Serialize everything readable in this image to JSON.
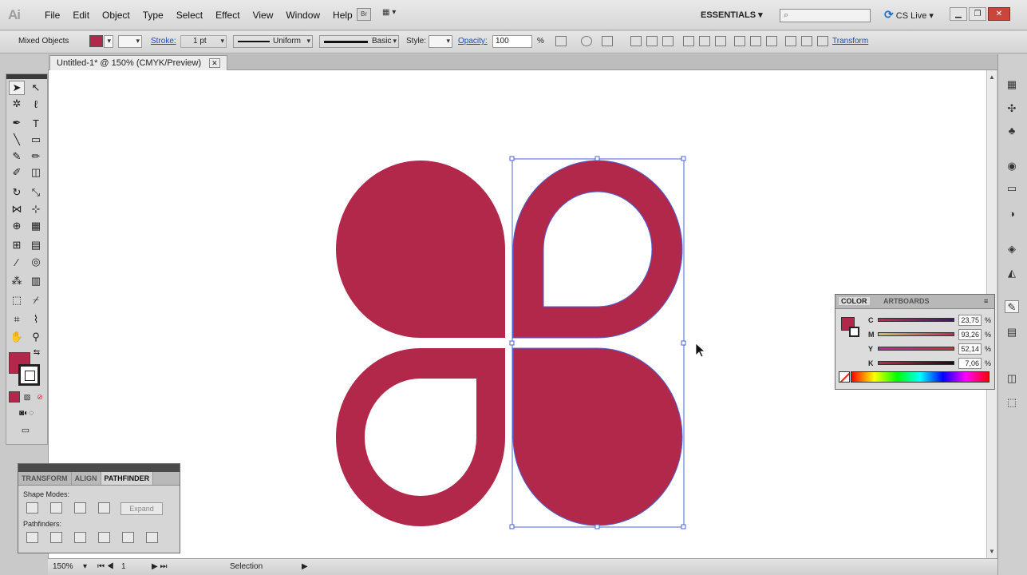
{
  "app": {
    "logo": "Ai",
    "essentials": "ESSENTIALS",
    "cslive": "CS Live",
    "bridge": "Br"
  },
  "menu": [
    "File",
    "Edit",
    "Object",
    "Type",
    "Select",
    "Effect",
    "View",
    "Window",
    "Help"
  ],
  "control_bar": {
    "selection_label": "Mixed Objects",
    "stroke_label": "Stroke:",
    "stroke_weight": "1 pt",
    "profile": "Uniform",
    "brush": "Basic",
    "style_label": "Style:",
    "opacity_label": "Opacity:",
    "opacity_value": "100",
    "opacity_unit": "%",
    "transform_link": "Transform"
  },
  "document": {
    "tab_title": "Untitled-1* @ 150% (CMYK/Preview)",
    "close": "✕"
  },
  "status": {
    "zoom": "150%",
    "artboard": "1",
    "tool": "Selection"
  },
  "pathfinder_panel": {
    "tabs": [
      "TRANSFORM",
      "ALIGN",
      "PATHFINDER"
    ],
    "shape_modes_label": "Shape Modes:",
    "expand_label": "Expand",
    "pathfinders_label": "Pathfinders:"
  },
  "color_panel": {
    "tabs": [
      "COLOR",
      "ARTBOARDS"
    ],
    "sliders": [
      {
        "label": "C",
        "value": "23,75"
      },
      {
        "label": "M",
        "value": "93,26"
      },
      {
        "label": "Y",
        "value": "52,14"
      },
      {
        "label": "K",
        "value": "7,06"
      }
    ],
    "percent": "%"
  },
  "colors": {
    "artwork": "#b2284b",
    "selection": "#4a63d8"
  }
}
